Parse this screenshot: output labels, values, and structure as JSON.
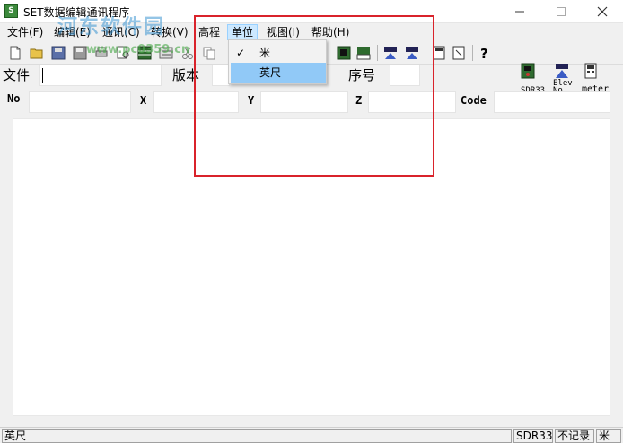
{
  "window": {
    "title": "SET数据编辑通讯程序",
    "app_icon_glyph": "S"
  },
  "watermark": {
    "text": "河东软件园",
    "url": "www.pc0359.cn"
  },
  "menu": {
    "items": [
      {
        "label": "文件(F)"
      },
      {
        "label": "编辑(E)"
      },
      {
        "label": "通讯(C)"
      },
      {
        "label": "转换(V)"
      },
      {
        "label": "高程"
      },
      {
        "label": "单位"
      },
      {
        "label": "视图(I)"
      },
      {
        "label": "帮助(H)"
      }
    ],
    "active_index": 5
  },
  "unit_dropdown": {
    "items": [
      {
        "label": "米",
        "checked": true
      },
      {
        "label": "英尺",
        "checked": false
      }
    ],
    "check_glyph": "✓"
  },
  "header_fields": {
    "file_label": "文件",
    "file_value": "",
    "version_label": "版本",
    "serial_label": "序号"
  },
  "coord_fields": {
    "no_label": "No",
    "x_label": "X",
    "y_label": "Y",
    "z_label": "Z",
    "code_label": "Code"
  },
  "right_panel": {
    "sdr_label": "SDR33",
    "elev_label_1": "Elev",
    "elev_label_2": "No",
    "meter_label": "meter"
  },
  "status_bar": {
    "unit": "英尺",
    "format": "SDR33",
    "record": "不记录",
    "unit2": "米"
  },
  "colors": {
    "highlight_box": "#d9232b",
    "menu_active": "#cce8ff",
    "dropdown_hover": "#91c9f7"
  }
}
